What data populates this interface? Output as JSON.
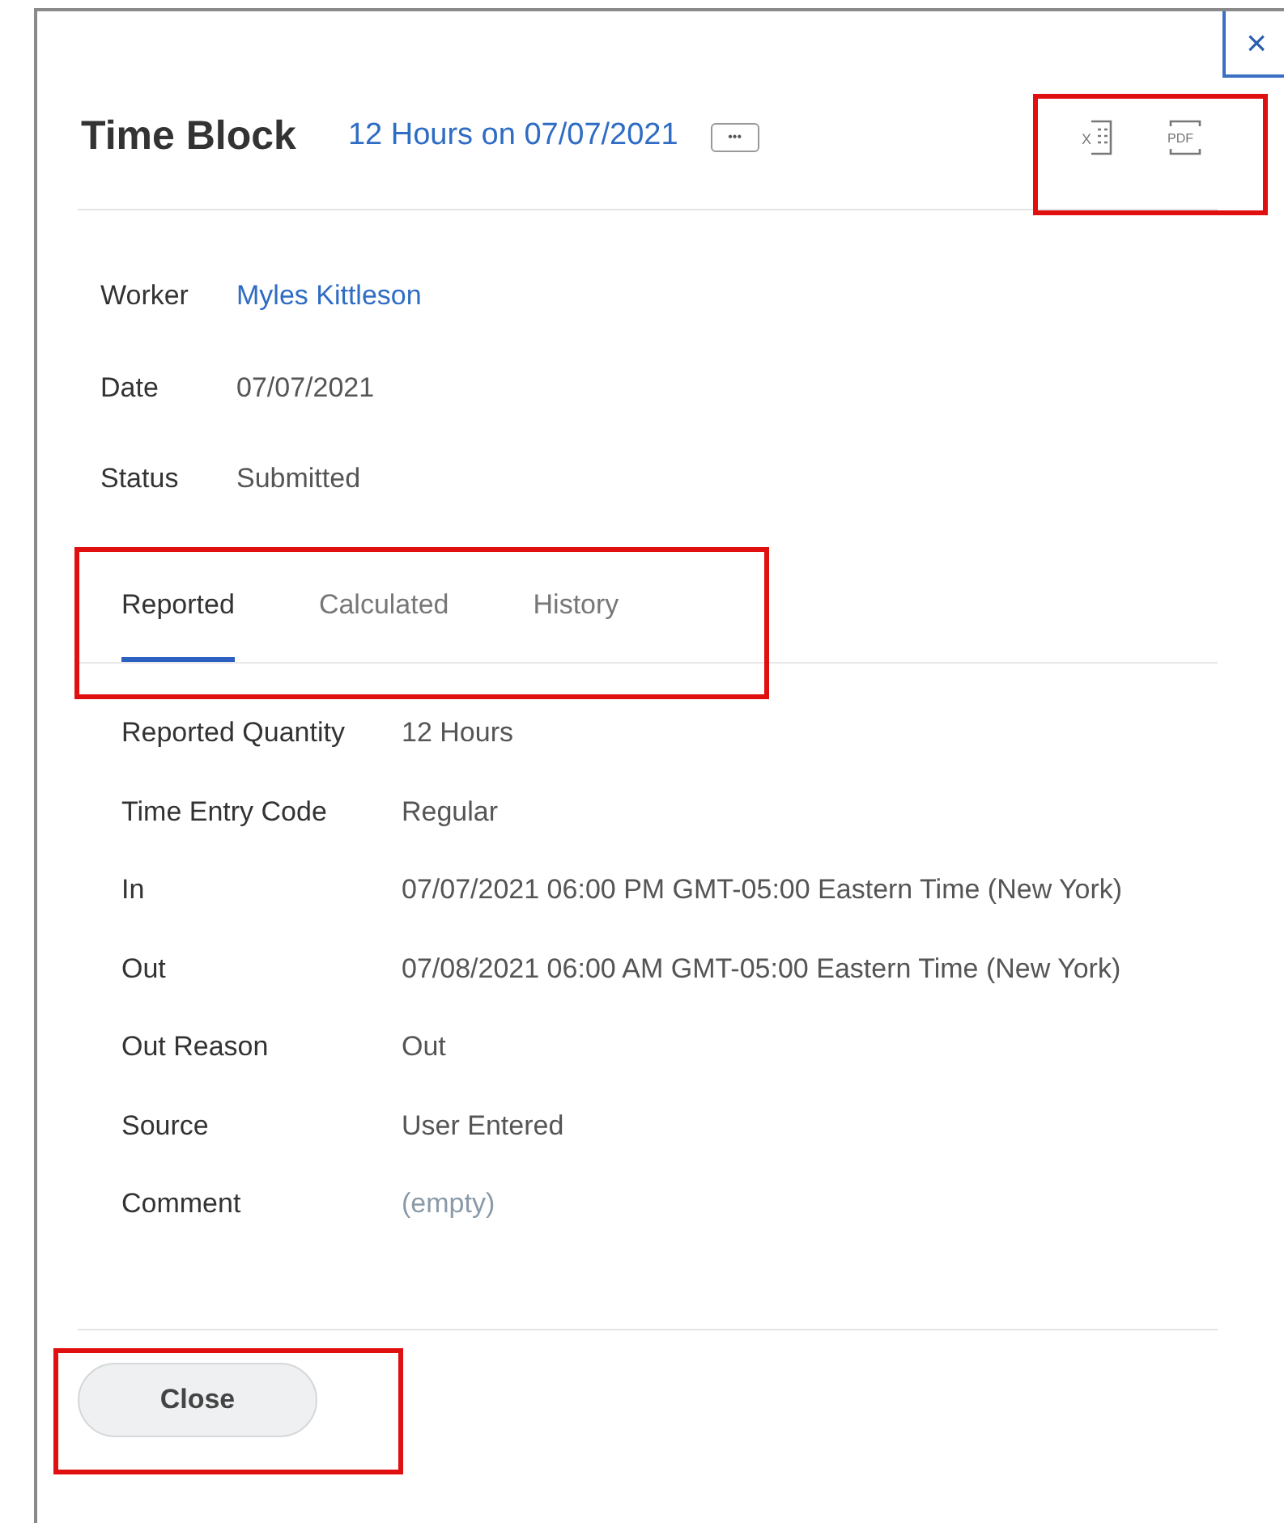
{
  "close_icon": "×",
  "header": {
    "title": "Time Block",
    "subtitle": "12 Hours on 07/07/2021",
    "more": "•••"
  },
  "export": [
    "X",
    "PDF"
  ],
  "summary": [
    {
      "label": "Worker",
      "value": "Myles Kittleson",
      "kind": "link"
    },
    {
      "label": "Date",
      "value": "07/07/2021",
      "kind": "text"
    },
    {
      "label": "Status",
      "value": "Submitted",
      "kind": "text"
    }
  ],
  "tabs": [
    {
      "label": "Reported",
      "selected": true
    },
    {
      "label": "Calculated",
      "selected": false
    },
    {
      "label": "History",
      "selected": false
    }
  ],
  "details": [
    {
      "label": "Reported Quantity",
      "value": "12 Hours",
      "kind": "text"
    },
    {
      "label": "Time Entry Code",
      "value": "Regular",
      "kind": "text"
    },
    {
      "label": "In",
      "value": "07/07/2021 06:00 PM GMT-05:00 Eastern Time (New York)",
      "kind": "text"
    },
    {
      "label": "Out",
      "value": "07/08/2021 06:00 AM GMT-05:00 Eastern Time (New York)",
      "kind": "text"
    },
    {
      "label": "Out Reason",
      "value": "Out",
      "kind": "text"
    },
    {
      "label": "Source",
      "value": "User Entered",
      "kind": "text"
    },
    {
      "label": "Comment",
      "value": "(empty)",
      "kind": "empty"
    }
  ],
  "buttons": [
    "Close"
  ]
}
